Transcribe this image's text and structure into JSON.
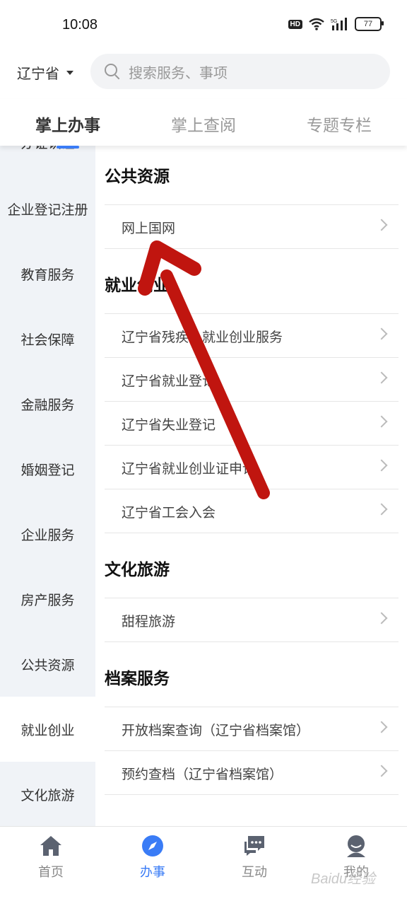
{
  "status": {
    "time": "10:08",
    "battery": "77",
    "hd": "HD",
    "net": "5G"
  },
  "header": {
    "province": "辽宁省",
    "search_placeholder": "搜索服务、事项"
  },
  "tabs": [
    {
      "label": "掌上办事",
      "active": true
    },
    {
      "label": "掌上查阅",
      "active": false
    },
    {
      "label": "专题专栏",
      "active": false
    }
  ],
  "sidebar": {
    "partial_item": "办证认证",
    "items": [
      {
        "label": "企业登记注册"
      },
      {
        "label": "教育服务"
      },
      {
        "label": "社会保障"
      },
      {
        "label": "金融服务"
      },
      {
        "label": "婚姻登记"
      },
      {
        "label": "企业服务"
      },
      {
        "label": "房产服务"
      },
      {
        "label": "公共资源"
      },
      {
        "label": "就业创业",
        "active": true
      },
      {
        "label": "文化旅游"
      }
    ]
  },
  "content": {
    "sections": [
      {
        "title": "公共资源",
        "items": [
          "网上国网"
        ]
      },
      {
        "title": "就业创业",
        "items": [
          "辽宁省残疾人就业创业服务",
          "辽宁省就业登记",
          "辽宁省失业登记",
          "辽宁省就业创业证申请",
          "辽宁省工会入会"
        ]
      },
      {
        "title": "文化旅游",
        "items": [
          "甜程旅游"
        ]
      },
      {
        "title": "档案服务",
        "items": [
          "开放档案查询（辽宁省档案馆）",
          "预约查档（辽宁省档案馆）"
        ]
      }
    ]
  },
  "bottom_nav": [
    {
      "label": "首页",
      "icon": "home-icon"
    },
    {
      "label": "办事",
      "icon": "compass-icon",
      "active": true
    },
    {
      "label": "互动",
      "icon": "chat-icon"
    },
    {
      "label": "我的",
      "icon": "user-icon"
    }
  ],
  "watermark": "Baidu经验",
  "colors": {
    "accent": "#3a7cf6",
    "arrow": "#c0150f",
    "sidebar_bg": "#f0f3f7"
  }
}
